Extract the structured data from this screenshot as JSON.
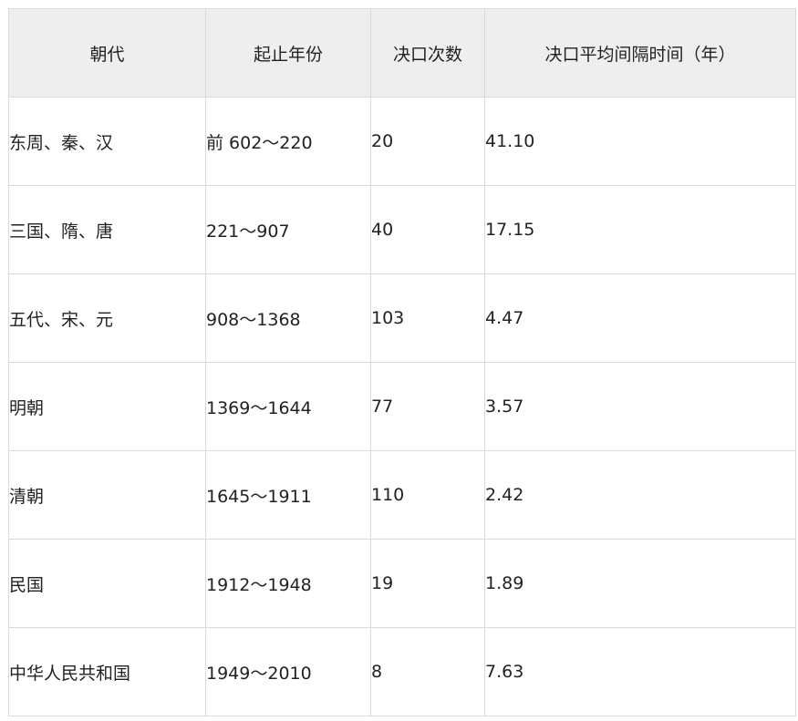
{
  "table": {
    "headers": [
      "朝代",
      "起止年份",
      "决口次数",
      "决口平均间隔时间（年）"
    ],
    "rows": [
      [
        "东周、秦、汉",
        "前 602～220",
        "20",
        "41.10"
      ],
      [
        "三国、隋、唐",
        "221～907",
        "40",
        "17.15"
      ],
      [
        "五代、宋、元",
        "908～1368",
        "103",
        "4.47"
      ],
      [
        "明朝",
        "1369～1644",
        "77",
        "3.57"
      ],
      [
        "清朝",
        "1645～1911",
        "110",
        "2.42"
      ],
      [
        "民国",
        "1912～1948",
        "19",
        "1.89"
      ],
      [
        "中华人民共和国",
        "1949～2010",
        "8",
        "7.63"
      ]
    ]
  }
}
